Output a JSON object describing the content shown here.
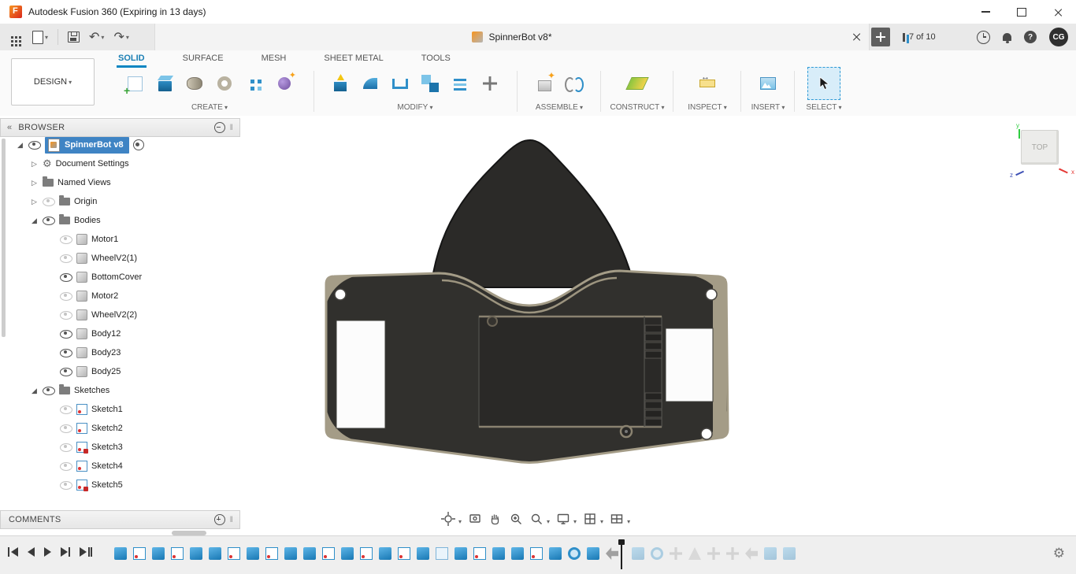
{
  "titlebar": {
    "title": "Autodesk Fusion 360 (Expiring in 13 days)"
  },
  "appbar": {
    "document_tab": "SpinnerBot v8*",
    "job_status": "7 of 10",
    "avatar_initials": "CG",
    "icons": [
      "app-grid-icon",
      "file-icon",
      "save-icon",
      "undo-icon",
      "redo-icon",
      "close-document-icon",
      "new-document-icon",
      "job-status-icon",
      "clock-icon",
      "notifications-bell-icon",
      "help-icon"
    ]
  },
  "ribbon": {
    "design_menu": "DESIGN",
    "tabs": [
      {
        "label": "SOLID",
        "active": true
      },
      {
        "label": "SURFACE",
        "active": false
      },
      {
        "label": "MESH",
        "active": false
      },
      {
        "label": "SHEET METAL",
        "active": false
      },
      {
        "label": "TOOLS",
        "active": false
      }
    ],
    "groups": [
      {
        "label": "CREATE",
        "tools": [
          "create-sketch",
          "extrude",
          "revolve",
          "sweep",
          "pattern",
          "coil"
        ]
      },
      {
        "label": "MODIFY",
        "tools": [
          "press-pull",
          "fillet",
          "shell",
          "combine",
          "offset",
          "move"
        ]
      },
      {
        "label": "ASSEMBLE",
        "tools": [
          "new-component",
          "joint"
        ]
      },
      {
        "label": "CONSTRUCT",
        "tools": [
          "construction-plane"
        ]
      },
      {
        "label": "INSPECT",
        "tools": [
          "measure"
        ]
      },
      {
        "label": "INSERT",
        "tools": [
          "insert-image"
        ]
      },
      {
        "label": "SELECT",
        "tools": [
          "select"
        ]
      }
    ]
  },
  "browser": {
    "header": "BROWSER",
    "comments_header": "COMMENTS",
    "tree": [
      {
        "label": "SpinnerBot v8",
        "icon": "document",
        "eye": "on",
        "expander": "expanded",
        "indent": 0,
        "selected": true,
        "activated_radio": true
      },
      {
        "label": "Document Settings",
        "icon": "gear",
        "eye": "none",
        "expander": "collapsed",
        "indent": 1
      },
      {
        "label": "Named Views",
        "icon": "folder",
        "eye": "none",
        "expander": "collapsed",
        "indent": 1
      },
      {
        "label": "Origin",
        "icon": "folder",
        "eye": "off",
        "expander": "collapsed",
        "indent": 1
      },
      {
        "label": "Bodies",
        "icon": "folder",
        "eye": "on",
        "expander": "expanded",
        "indent": 1
      },
      {
        "label": "Motor1",
        "icon": "body",
        "eye": "off",
        "indent": 2
      },
      {
        "label": "WheelV2(1)",
        "icon": "body",
        "eye": "off",
        "indent": 2
      },
      {
        "label": "BottomCover",
        "icon": "body",
        "eye": "on",
        "indent": 2
      },
      {
        "label": "Motor2",
        "icon": "body",
        "eye": "off",
        "indent": 2
      },
      {
        "label": "WheelV2(2)",
        "icon": "body",
        "eye": "off",
        "indent": 2
      },
      {
        "label": "Body12",
        "icon": "body",
        "eye": "on",
        "indent": 2
      },
      {
        "label": "Body23",
        "icon": "body",
        "eye": "on",
        "indent": 2
      },
      {
        "label": "Body25",
        "icon": "body",
        "eye": "on",
        "indent": 2
      },
      {
        "label": "Sketches",
        "icon": "folder",
        "eye": "on",
        "expander": "expanded",
        "indent": 1
      },
      {
        "label": "Sketch1",
        "icon": "sketch",
        "eye": "off",
        "indent": 2
      },
      {
        "label": "Sketch2",
        "icon": "sketch",
        "eye": "off",
        "indent": 2
      },
      {
        "label": "Sketch3",
        "icon": "sketch-locked",
        "eye": "off",
        "indent": 2
      },
      {
        "label": "Sketch4",
        "icon": "sketch",
        "eye": "off",
        "indent": 2
      },
      {
        "label": "Sketch5",
        "icon": "sketch-locked",
        "eye": "off",
        "indent": 2
      }
    ]
  },
  "viewcube": {
    "face": "TOP",
    "axis_x": "x",
    "axis_y": "y",
    "axis_z": "z"
  },
  "navbar": {
    "icons": [
      "orbit",
      "look-at",
      "pan",
      "fit",
      "zoom",
      "display-settings",
      "grid-snap",
      "viewports"
    ]
  },
  "timeline": {
    "playback": [
      "skip-to-start",
      "step-back",
      "play",
      "step-forward",
      "skip-to-end"
    ],
    "icons_before": [
      {
        "t": "solid"
      },
      {
        "t": "sketch"
      },
      {
        "t": "solid"
      },
      {
        "t": "sketch"
      },
      {
        "t": "solid"
      },
      {
        "t": "solid"
      },
      {
        "t": "sketch"
      },
      {
        "t": "solid"
      },
      {
        "t": "sketch"
      },
      {
        "t": "solid"
      },
      {
        "t": "solid"
      },
      {
        "t": "sketch"
      },
      {
        "t": "solid"
      },
      {
        "t": "sketch"
      },
      {
        "t": "solid"
      },
      {
        "t": "sketch"
      },
      {
        "t": "solid"
      },
      {
        "t": "doc"
      },
      {
        "t": "solid"
      },
      {
        "t": "sketch"
      },
      {
        "t": "solid"
      },
      {
        "t": "solid"
      },
      {
        "t": "sketch"
      },
      {
        "t": "solid"
      },
      {
        "t": "circle"
      },
      {
        "t": "solid"
      },
      {
        "t": "arrow"
      }
    ],
    "icons_after": [
      {
        "t": "solid",
        "f": true
      },
      {
        "t": "circle",
        "f": true
      },
      {
        "t": "cross",
        "f": true
      },
      {
        "t": "tri",
        "f": true
      },
      {
        "t": "cross",
        "f": true
      },
      {
        "t": "cross",
        "f": true
      },
      {
        "t": "arrow",
        "f": true
      },
      {
        "t": "solid",
        "f": true
      },
      {
        "t": "solid",
        "f": true
      }
    ]
  },
  "colors": {
    "accent": "#0a86c2",
    "selection": "#3f84c4",
    "model_dark": "#31302d",
    "model_tan": "#a49c87"
  }
}
